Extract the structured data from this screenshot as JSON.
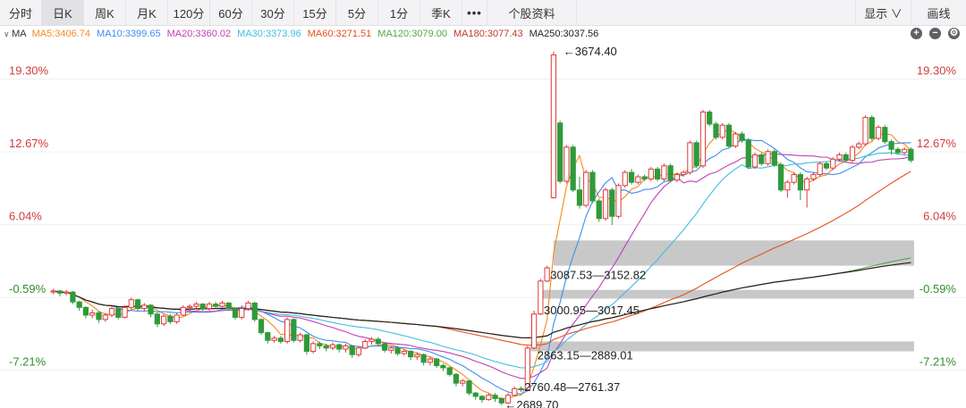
{
  "toolbar": {
    "tabs": [
      "分时",
      "日K",
      "周K",
      "月K",
      "120分",
      "60分",
      "30分",
      "15分",
      "5分",
      "1分",
      "季K",
      "•••",
      "个股资料"
    ],
    "active": "日K",
    "display": "显示 ∨",
    "draw": "画线"
  },
  "ma_bar": {
    "label": "MA",
    "items": [
      {
        "text": "MA5:3406.74",
        "color": "#f28a22"
      },
      {
        "text": "MA10:3399.65",
        "color": "#3b8ff0"
      },
      {
        "text": "MA20:3360.02",
        "color": "#c33fb7"
      },
      {
        "text": "MA30:3373.96",
        "color": "#3fbde0"
      },
      {
        "text": "MA60:3271.51",
        "color": "#e8501c"
      },
      {
        "text": "MA120:3079.00",
        "color": "#5aa34d"
      },
      {
        "text": "MA180:3077.43",
        "color": "#c0392b"
      },
      {
        "text": "MA250:3037.56",
        "color": "#222222"
      }
    ],
    "controls": [
      "+",
      "−",
      "⚙"
    ]
  },
  "chart_data": {
    "type": "candlestick",
    "y_axis_percent": {
      "ticks": [
        "19.30%",
        "12.67%",
        "6.04%",
        "-0.59%",
        "-7.21%"
      ],
      "values": [
        19.3,
        12.67,
        6.04,
        -0.59,
        -7.21
      ],
      "ylim": [
        -10.5,
        22.6
      ]
    },
    "colors": {
      "up": "#e03a3a",
      "down": "#2f9a3a",
      "gap_zone": "#c8c8c8",
      "axis_up": "#d23b3b",
      "axis_down": "#2f8f2f"
    },
    "candles": [
      [
        -0.1,
        0,
        -0.3,
        0.2
      ],
      [
        0,
        -0.2,
        -0.5,
        0.1
      ],
      [
        -0.2,
        -0.1,
        -0.4,
        0.1
      ],
      [
        -0.1,
        -1.0,
        -1.2,
        0
      ],
      [
        -1.0,
        -1.5,
        -1.8,
        -0.9
      ],
      [
        -1.5,
        -2.2,
        -2.5,
        -1.4
      ],
      [
        -2.2,
        -2.0,
        -2.5,
        -1.7
      ],
      [
        -2.0,
        -2.6,
        -2.9,
        -1.8
      ],
      [
        -2.6,
        -2.2,
        -2.8,
        -2.0
      ],
      [
        -2.2,
        -1.6,
        -2.4,
        -1.4
      ],
      [
        -1.6,
        -2.4,
        -2.6,
        -1.5
      ],
      [
        -2.4,
        -1.5,
        -2.5,
        -1.3
      ],
      [
        -1.5,
        -0.8,
        -1.7,
        -0.6
      ],
      [
        -0.8,
        -1.6,
        -1.8,
        -0.7
      ],
      [
        -1.6,
        -1.3,
        -1.9,
        -1.1
      ],
      [
        -1.3,
        -2.1,
        -2.4,
        -1.2
      ],
      [
        -2.1,
        -3.0,
        -3.3,
        -2.0
      ],
      [
        -3.0,
        -2.3,
        -3.2,
        -2.1
      ],
      [
        -2.3,
        -2.8,
        -3.0,
        -2.1
      ],
      [
        -2.8,
        -2.2,
        -3.0,
        -2.0
      ],
      [
        -2.2,
        -1.5,
        -2.3,
        -1.3
      ],
      [
        -1.5,
        -1.4,
        -1.8,
        -1.2
      ],
      [
        -1.4,
        -1.2,
        -1.6,
        -1.0
      ],
      [
        -1.2,
        -1.6,
        -1.8,
        -1.1
      ],
      [
        -1.6,
        -1.2,
        -1.8,
        -1.0
      ],
      [
        -1.2,
        -1.4,
        -1.6,
        -1.0
      ],
      [
        -1.4,
        -1.1,
        -1.5,
        -0.9
      ],
      [
        -1.1,
        -1.6,
        -1.8,
        -1.0
      ],
      [
        -1.6,
        -2.4,
        -2.6,
        -1.5
      ],
      [
        -2.4,
        -1.6,
        -2.6,
        -1.3
      ],
      [
        -1.6,
        -1.1,
        -1.8,
        -0.9
      ],
      [
        -1.1,
        -2.6,
        -2.8,
        -1.0
      ],
      [
        -2.6,
        -3.8,
        -4.0,
        -2.5
      ],
      [
        -3.8,
        -4.5,
        -4.8,
        -3.7
      ],
      [
        -4.5,
        -4.3,
        -4.7,
        -4.1
      ],
      [
        -4.3,
        -4.6,
        -4.8,
        -4.1
      ],
      [
        -4.6,
        -2.6,
        -4.8,
        -2.4
      ],
      [
        -2.6,
        -4.5,
        -4.7,
        -2.5
      ],
      [
        -4.5,
        -4.0,
        -4.7,
        -3.8
      ],
      [
        -4.0,
        -5.5,
        -5.8,
        -3.9
      ],
      [
        -5.5,
        -4.8,
        -5.7,
        -4.6
      ],
      [
        -4.8,
        -5.0,
        -5.3,
        -4.6
      ],
      [
        -5.0,
        -5.2,
        -5.5,
        -4.8
      ],
      [
        -5.2,
        -4.9,
        -5.4,
        -4.7
      ],
      [
        -4.9,
        -5.3,
        -5.6,
        -4.8
      ],
      [
        -5.3,
        -5.0,
        -5.6,
        -4.8
      ],
      [
        -5.0,
        -5.8,
        -6.1,
        -4.9
      ],
      [
        -5.8,
        -5.2,
        -6.0,
        -5.0
      ],
      [
        -5.2,
        -4.6,
        -5.3,
        -4.4
      ],
      [
        -4.6,
        -4.4,
        -4.9,
        -4.2
      ],
      [
        -4.4,
        -4.8,
        -5.0,
        -4.2
      ],
      [
        -4.8,
        -5.4,
        -5.6,
        -4.7
      ],
      [
        -5.4,
        -5.2,
        -5.7,
        -5.0
      ],
      [
        -5.2,
        -5.7,
        -5.9,
        -5.0
      ],
      [
        -5.7,
        -5.5,
        -5.9,
        -5.3
      ],
      [
        -5.5,
        -6.0,
        -6.3,
        -5.4
      ],
      [
        -6.0,
        -5.8,
        -6.3,
        -5.6
      ],
      [
        -5.8,
        -6.5,
        -6.8,
        -5.7
      ],
      [
        -6.5,
        -6.2,
        -6.8,
        -6.0
      ],
      [
        -6.2,
        -6.8,
        -7.0,
        -6.1
      ],
      [
        -6.8,
        -7.0,
        -7.3,
        -6.6
      ],
      [
        -7.0,
        -7.6,
        -7.8,
        -6.9
      ],
      [
        -7.6,
        -8.4,
        -8.7,
        -7.5
      ],
      [
        -8.4,
        -8.2,
        -8.7,
        -8.0
      ],
      [
        -8.2,
        -9.3,
        -9.5,
        -8.1
      ],
      [
        -9.3,
        -9.6,
        -9.9,
        -9.2
      ],
      [
        -9.6,
        -9.9,
        -10.2,
        -9.5
      ],
      [
        -9.9,
        -9.5,
        -10.0,
        -9.3
      ],
      [
        -9.5,
        -9.8,
        -10.1,
        -9.3
      ],
      [
        -9.8,
        -10.2,
        -10.4,
        -9.7
      ],
      [
        -10.2,
        -9.5,
        -10.3,
        -9.3
      ],
      [
        -9.5,
        -8.9,
        -9.6,
        -8.7
      ],
      [
        -8.9,
        -9.0,
        -9.2,
        -8.7
      ],
      [
        -9.0,
        -5.2,
        -9.1,
        -5.0
      ],
      [
        -5.2,
        -2.1,
        -5.3,
        -1.8
      ],
      [
        -2.1,
        0.9,
        -2.2,
        1.1
      ],
      [
        0.9,
        2.1,
        0.8,
        2.3
      ],
      [
        8.5,
        21.5,
        8.4,
        21.8
      ],
      [
        15.3,
        10.0,
        9.8,
        15.5
      ],
      [
        10.0,
        13.1,
        9.8,
        13.3
      ],
      [
        13.1,
        9.2,
        9.0,
        13.3
      ],
      [
        9.2,
        7.8,
        7.5,
        10.4
      ],
      [
        7.8,
        10.8,
        7.6,
        11.0
      ],
      [
        10.8,
        8.2,
        8.0,
        11.0
      ],
      [
        8.2,
        6.6,
        6.3,
        8.4
      ],
      [
        6.6,
        9.2,
        6.4,
        9.4
      ],
      [
        9.2,
        6.8,
        6.0,
        9.4
      ],
      [
        6.8,
        9.6,
        6.6,
        9.8
      ],
      [
        9.6,
        10.8,
        9.4,
        11.0
      ],
      [
        10.8,
        9.9,
        9.7,
        11.1
      ],
      [
        9.9,
        10.4,
        9.7,
        10.6
      ],
      [
        10.4,
        10.2,
        10.0,
        10.6
      ],
      [
        10.2,
        11.1,
        10.0,
        11.3
      ],
      [
        11.1,
        10.2,
        10.0,
        11.3
      ],
      [
        10.2,
        11.4,
        10.0,
        11.6
      ],
      [
        11.4,
        10.1,
        9.9,
        11.6
      ],
      [
        10.1,
        10.6,
        9.9,
        10.8
      ],
      [
        10.6,
        10.8,
        10.4,
        11.0
      ],
      [
        10.8,
        13.5,
        10.6,
        13.7
      ],
      [
        13.5,
        11.4,
        11.2,
        13.7
      ],
      [
        11.4,
        16.3,
        11.2,
        16.5
      ],
      [
        16.3,
        15.2,
        15.0,
        16.5
      ],
      [
        15.2,
        14.0,
        13.8,
        15.4
      ],
      [
        14.0,
        15.1,
        13.8,
        15.3
      ],
      [
        15.1,
        13.2,
        13.0,
        15.3
      ],
      [
        13.2,
        14.3,
        13.0,
        14.5
      ],
      [
        14.3,
        13.7,
        13.5,
        14.5
      ],
      [
        13.7,
        11.3,
        11.1,
        13.9
      ],
      [
        11.3,
        12.4,
        11.1,
        12.6
      ],
      [
        12.4,
        11.6,
        11.4,
        12.6
      ],
      [
        11.6,
        12.7,
        11.4,
        12.9
      ],
      [
        12.7,
        11.5,
        11.3,
        12.9
      ],
      [
        11.5,
        9.2,
        9.0,
        11.7
      ],
      [
        9.2,
        9.9,
        8.5,
        10.1
      ],
      [
        9.9,
        10.6,
        9.7,
        10.8
      ],
      [
        10.6,
        9.2,
        8.3,
        10.8
      ],
      [
        9.2,
        10.2,
        7.6,
        10.4
      ],
      [
        10.2,
        10.6,
        10.0,
        10.8
      ],
      [
        10.6,
        11.6,
        10.4,
        11.8
      ],
      [
        11.6,
        11.2,
        11.0,
        11.8
      ],
      [
        11.2,
        12.0,
        11.0,
        12.2
      ],
      [
        12.0,
        12.4,
        11.8,
        12.6
      ],
      [
        12.4,
        11.9,
        11.7,
        12.6
      ],
      [
        11.9,
        13.1,
        11.7,
        13.3
      ],
      [
        13.1,
        13.4,
        12.9,
        13.6
      ],
      [
        13.4,
        15.8,
        13.2,
        16.0
      ],
      [
        15.8,
        13.9,
        13.7,
        16.0
      ],
      [
        13.9,
        14.9,
        13.7,
        15.1
      ],
      [
        14.9,
        13.6,
        13.4,
        15.1
      ],
      [
        13.6,
        12.9,
        12.4,
        13.8
      ],
      [
        12.9,
        12.6,
        12.4,
        13.1
      ],
      [
        12.6,
        12.9,
        12.4,
        13.1
      ],
      [
        12.9,
        11.9,
        11.7,
        13.1
      ]
    ],
    "price_annotations": [
      {
        "text": "←3674.40",
        "x": 78.5,
        "y": 21.8
      },
      {
        "text": "3087.53—3152.82",
        "x": 76.5,
        "y": 1.4
      },
      {
        "text": "3000.95—3017.45",
        "x": 75.5,
        "y": -1.8
      },
      {
        "text": "2863.15—2889.01",
        "x": 74.5,
        "y": -5.9
      },
      {
        "text": "2760.48—2761.37",
        "x": 72.5,
        "y": -8.8
      },
      {
        "text": "←2689.70",
        "x": 69.5,
        "y": -10.4
      }
    ],
    "gap_zones": [
      {
        "x0": 77.5,
        "y0": 2.3,
        "y1": 4.6
      },
      {
        "x0": 75.5,
        "y0": -0.7,
        "y1": 0.1
      },
      {
        "x0": 74.0,
        "y0": -4.6,
        "y1": -5.5
      }
    ]
  }
}
